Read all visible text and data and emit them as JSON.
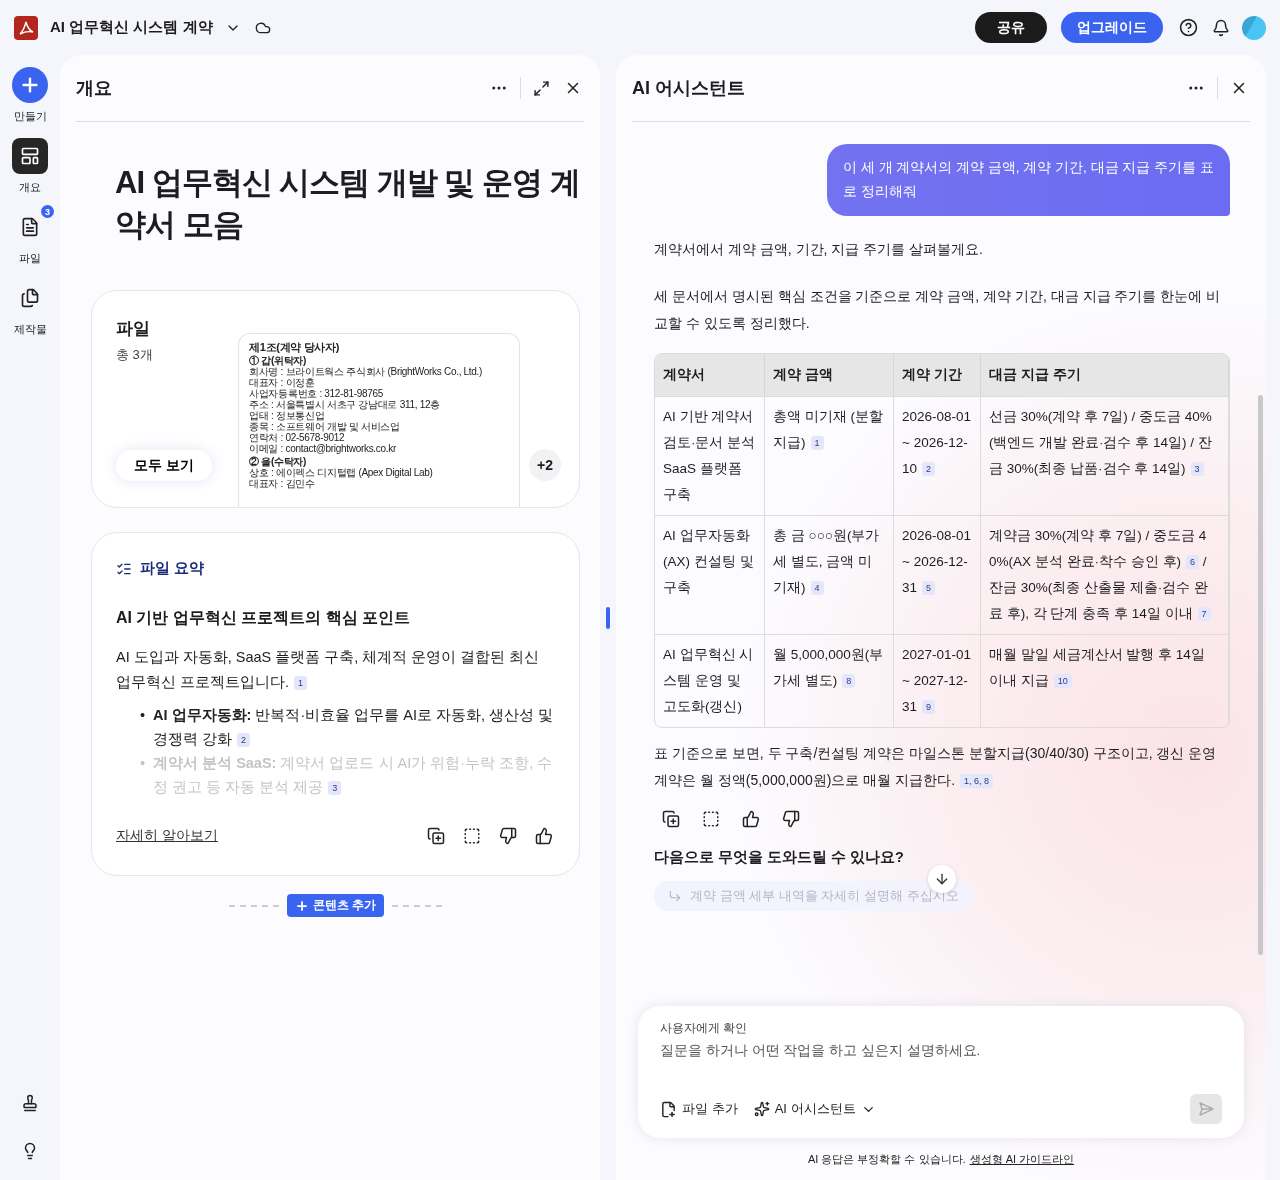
{
  "app_bar": {
    "title": "AI 업무혁신 시스템 계약",
    "share_button": "공유",
    "upgrade_button": "업그레이드"
  },
  "rail": {
    "items": [
      {
        "kind": "create",
        "label": "만들기"
      },
      {
        "kind": "overview",
        "label": "개요",
        "selected": true
      },
      {
        "kind": "files",
        "label": "파일",
        "selected": false,
        "badge": "3"
      },
      {
        "kind": "artifacts",
        "label": "제작물",
        "selected": false
      }
    ]
  },
  "overview_panel": {
    "header": "개요",
    "title": "AI 업무혁신 시스템 개발 및 운영 계약서 모음",
    "files_card": {
      "heading": "파일",
      "count": "총 3개",
      "view_all": "모두 보기",
      "more": "+2",
      "preview": [
        {
          "kind": "heading",
          "text": "제1조(계약 당사자)"
        },
        {
          "kind": "section",
          "text": "① 갑(위탁자)"
        },
        {
          "kind": "line",
          "text": "회사명 : 브라이트웍스 주식회사 (BrightWorks Co., Ltd.)"
        },
        {
          "kind": "line",
          "text": "대표자 : 이정훈"
        },
        {
          "kind": "line",
          "text": "사업자등록번호 : 312-81-98765"
        },
        {
          "kind": "line",
          "text": "주소 : 서울특별시 서초구 강남대로 311, 12층"
        },
        {
          "kind": "line",
          "text": "업태 : 정보통신업"
        },
        {
          "kind": "line",
          "text": "종목 : 소프트웨어 개발 및 서비스업"
        },
        {
          "kind": "line",
          "text": "연락처 : 02-5678-9012"
        },
        {
          "kind": "line",
          "text": "이메일 : contact@brightworks.co.kr"
        },
        {
          "kind": "section",
          "text": "② 을(수탁자)"
        },
        {
          "kind": "line",
          "text": "상호 : 에이펙스 디지털랩 (Apex Digital Lab)"
        },
        {
          "kind": "line",
          "text": "대표자 : 김민수"
        }
      ]
    },
    "summary_card": {
      "label": "파일 요약",
      "heading": "AI 기반 업무혁신 프로젝트의 핵심 포인트",
      "paragraph": {
        "text": "AI 도입과 자동화, SaaS 플랫폼 구축, 체계적 운영이 결합된 최신 업무혁신 프로젝트입니다.",
        "cite": "1"
      },
      "bullets": [
        {
          "marker": "•",
          "label": "AI 업무자동화:",
          "text": " 반복적·비효율 업무를 AI로 자동화, 생산성 및 경쟁력 강화",
          "cite": "2",
          "faded": false
        },
        {
          "marker": "•",
          "label": "계약서 분석 SaaS:",
          "text": " 계약서 업로드 시 AI가 위험·누락 조항, 수정 권고 등 자동 분석 제공",
          "cite": "3",
          "faded": true
        }
      ],
      "learn_more": "자세히 알아보기"
    },
    "add_content": "콘텐츠 추가"
  },
  "assistant_panel": {
    "header": "AI 어시스턴트",
    "user_message": "이 세 개 계약서의 계약 금액, 계약 기간, 대금 지급 주기를 표로 정리해줘",
    "intro": "계약서에서 계약 금액, 기간, 지급 주기를 살펴볼게요.",
    "lead": "세 문서에서 명시된 핵심 조건을 기준으로 계약 금액, 계약 기간, 대금 지급 주기를 한눈에 비교할 수 있도록 정리했다.",
    "table": {
      "columns": [
        "계약서",
        "계약 금액",
        "계약 기간",
        "대금 지급 주기"
      ],
      "rows": [
        [
          {
            "text": "AI 기반 계약서 검토·문서 분석 SaaS 플랫폼 구축"
          },
          {
            "text": "총액 미기재 (분할 지급)",
            "cite": "1"
          },
          {
            "text": "2026-08-01 ~ 2026-12-10",
            "cite": "2"
          },
          {
            "text": "선금 30%(계약 후 7일) / 중도금 40%(백엔드 개발 완료·검수 후 14일) / 잔금 30%(최종 납품·검수 후 14일)",
            "cite": "3"
          }
        ],
        [
          {
            "text": "AI 업무자동화(AX) 컨설팅 및 구축"
          },
          {
            "text": "총 금 ○○○원(부가세 별도, 금액 미기재)",
            "cite": "4"
          },
          {
            "text": "2026-08-01 ~ 2026-12-31",
            "cite": "5"
          },
          {
            "text": "계약금 30%(계약 후 7일) / 중도금 40%(AX 분석 완료·착수 승인 후)",
            "cite": "6",
            "tail": " / 잔금 30%(최종 산출물 제출·검수 완료 후), 각 단계 충족 후 14일 이내",
            "tail_cite": "7"
          }
        ],
        [
          {
            "text": "AI 업무혁신 시스템 운영 및 고도화(갱신)"
          },
          {
            "text": "월 5,000,000원(부가세 별도)",
            "cite": "8"
          },
          {
            "text": "2027-01-01 ~ 2027-12-31",
            "cite": "9"
          },
          {
            "text": "매월 말일 세금계산서 발행 후 14일 이내 지급",
            "cite": "10"
          }
        ]
      ]
    },
    "conclusion": {
      "text": "표 기준으로 보면, 두 구축/컨설팅 계약은 마일스톤 분할지급(30/40/30) 구조이고, 갱신 운영 계약은 월 정액(5,000,000원)으로 매월 지급한다.",
      "cite": "1, 6, 8"
    },
    "next_heading": "다음으로 무엇을 도와드릴 수 있나요?",
    "suggestion": "계약 금액 세부 내역을 자세히 설명해 주십시오",
    "input": {
      "label": "사용자에게 확인",
      "placeholder": "질문을 하거나 어떤 작업을 하고 싶은지 설명하세요.",
      "add_file": "파일 추가",
      "mode": "AI 어시스턴트"
    },
    "disclaimer": {
      "text": "AI 응답은 부정확할 수 있습니다.",
      "link": "생성형 AI 가이드라인"
    }
  }
}
